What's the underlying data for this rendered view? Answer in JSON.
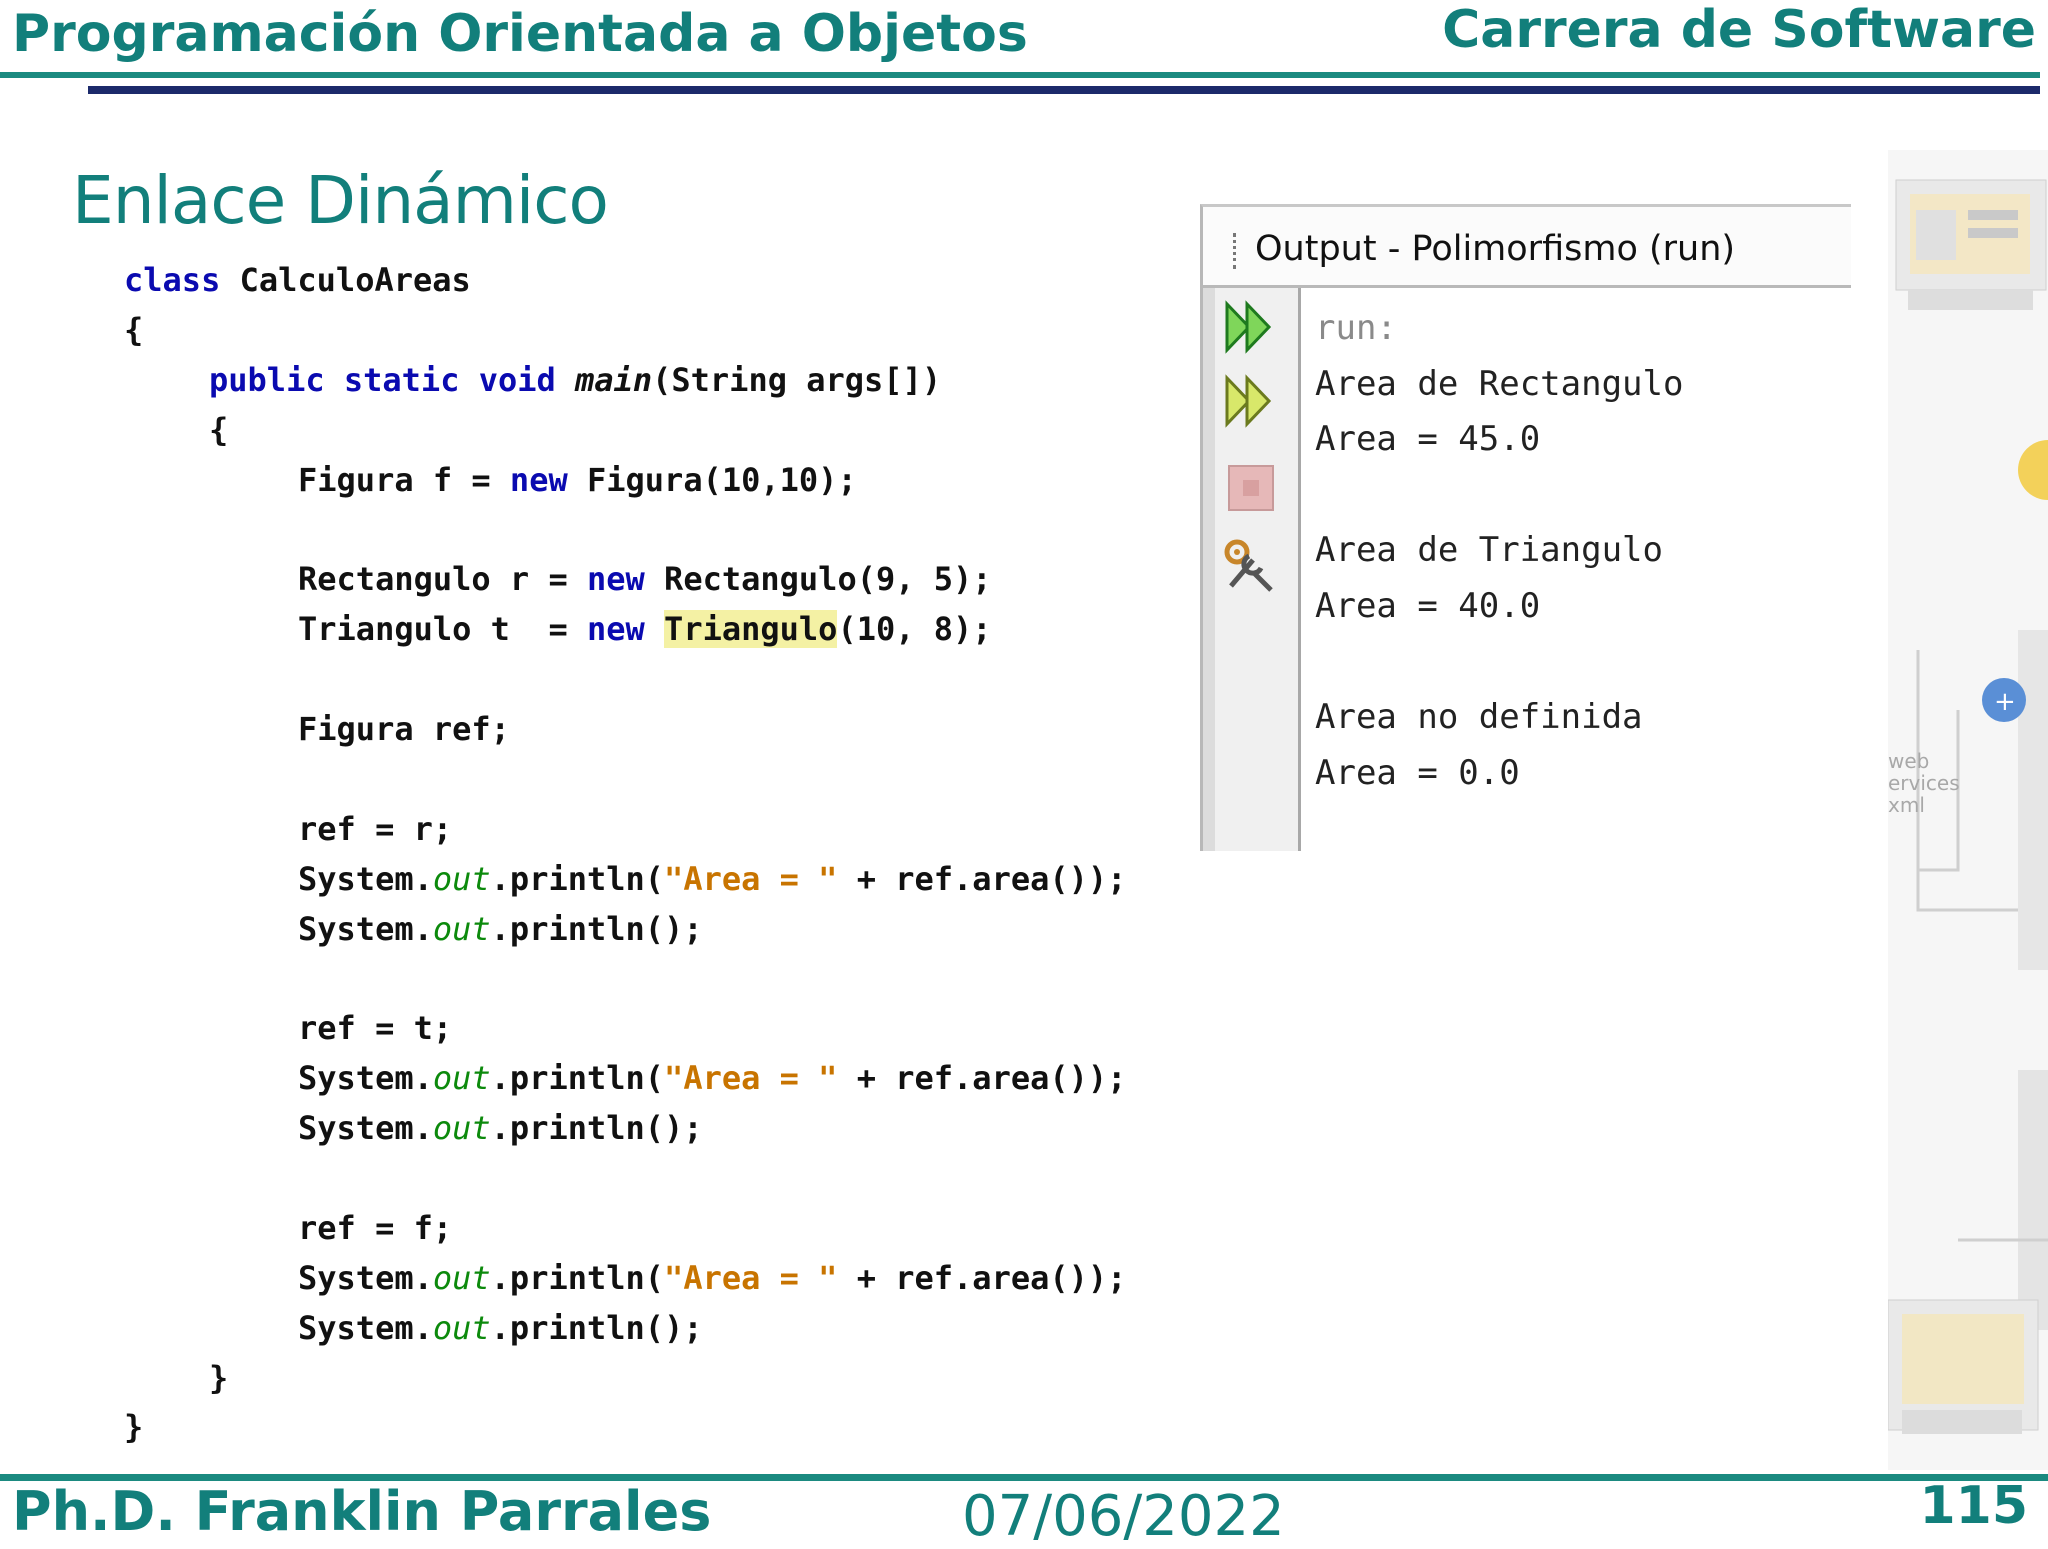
{
  "header": {
    "course": "Programación Orientada a Objetos",
    "career": "Carrera de Software"
  },
  "slide": {
    "title": "Enlace Dinámico"
  },
  "code": {
    "l01_kw": "class",
    "l01_rest": " CalculoAreas",
    "l02": "{",
    "l03_kw": "public static void",
    "l03_main": "main",
    "l03_rest": "(String args[])",
    "l04": "{",
    "l05_a": "Figura f = ",
    "l05_kw": "new",
    "l05_b": " Figura(10,10);",
    "l07_a": "Rectangulo r = ",
    "l07_kw": "new",
    "l07_b": " Rectangulo(9, 5);",
    "l08_a": "Triangulo t  = ",
    "l08_kw": "new",
    "l08_hl": "Triangulo",
    "l08_b": "(10, 8);",
    "l10": "Figura ref;",
    "l12": "ref = r;",
    "println_sys": "System.",
    "println_out": "out",
    "println_call": ".println(",
    "println_str": "\"Area = \"",
    "println_tail": " + ref.area());",
    "println_empty": ".println();",
    "l16": "ref = t;",
    "l20": "ref = f;",
    "l24": "}",
    "l25": "}"
  },
  "output": {
    "title": "Output - Polimorfismo (run)",
    "lines": [
      "run:",
      "Area de Rectangulo",
      "Area = 45.0",
      "",
      "Area de Triangulo",
      "Area = 40.0",
      "",
      "Area no definida",
      "Area = 0.0"
    ],
    "toolbar": [
      "rerun-icon",
      "rerun-with-options-icon",
      "stop-icon",
      "settings-icon"
    ]
  },
  "deco": {
    "web_services": "web\nervices\nxml"
  },
  "footer": {
    "author": "Ph.D. Franklin Parrales",
    "date": "07/06/2022",
    "page": "115"
  }
}
